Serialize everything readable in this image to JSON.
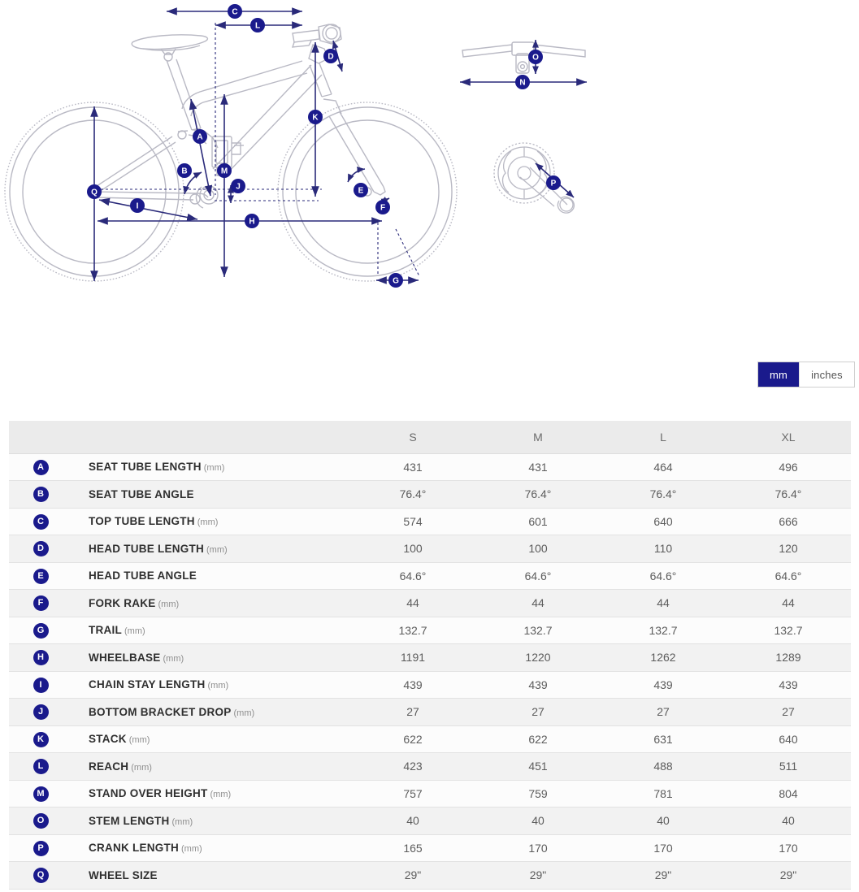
{
  "diagram": {
    "title": "bike-geometry-diagram",
    "line_color": "#2a2a7a",
    "frame_color": "#b9b9c4",
    "callouts": [
      {
        "id": "A",
        "name": "seat-tube-length"
      },
      {
        "id": "B",
        "name": "seat-tube-angle"
      },
      {
        "id": "C",
        "name": "top-tube-length"
      },
      {
        "id": "D",
        "name": "head-tube-length"
      },
      {
        "id": "E",
        "name": "head-tube-angle"
      },
      {
        "id": "F",
        "name": "fork-rake"
      },
      {
        "id": "G",
        "name": "trail"
      },
      {
        "id": "H",
        "name": "wheelbase"
      },
      {
        "id": "I",
        "name": "chain-stay-length"
      },
      {
        "id": "J",
        "name": "bottom-bracket-drop"
      },
      {
        "id": "K",
        "name": "stack"
      },
      {
        "id": "L",
        "name": "reach"
      },
      {
        "id": "M",
        "name": "stand-over-height"
      },
      {
        "id": "N",
        "name": "handlebar-width"
      },
      {
        "id": "O",
        "name": "stem-length"
      },
      {
        "id": "P",
        "name": "crank-length"
      },
      {
        "id": "Q",
        "name": "wheel-size"
      }
    ]
  },
  "units": {
    "selected": "mm",
    "options": [
      {
        "label": "mm",
        "active": true
      },
      {
        "label": "inches",
        "active": false
      }
    ],
    "mm_label": "mm",
    "inches_label": "inches",
    "accent_color": "#1a1a8c"
  },
  "table": {
    "columns": [
      "",
      "",
      "S",
      "M",
      "L",
      "XL"
    ],
    "size_headers": [
      "S",
      "M",
      "L",
      "XL"
    ],
    "rows": [
      {
        "badge": "A",
        "label": "SEAT TUBE LENGTH",
        "unit": "(mm)",
        "values": [
          "431",
          "431",
          "464",
          "496"
        ]
      },
      {
        "badge": "B",
        "label": "SEAT TUBE ANGLE",
        "unit": "",
        "values": [
          "76.4°",
          "76.4°",
          "76.4°",
          "76.4°"
        ]
      },
      {
        "badge": "C",
        "label": "TOP TUBE LENGTH",
        "unit": "(mm)",
        "values": [
          "574",
          "601",
          "640",
          "666"
        ]
      },
      {
        "badge": "D",
        "label": "HEAD TUBE LENGTH",
        "unit": "(mm)",
        "values": [
          "100",
          "100",
          "110",
          "120"
        ]
      },
      {
        "badge": "E",
        "label": "HEAD TUBE ANGLE",
        "unit": "",
        "values": [
          "64.6°",
          "64.6°",
          "64.6°",
          "64.6°"
        ]
      },
      {
        "badge": "F",
        "label": "FORK RAKE",
        "unit": "(mm)",
        "values": [
          "44",
          "44",
          "44",
          "44"
        ]
      },
      {
        "badge": "G",
        "label": "TRAIL",
        "unit": "(mm)",
        "values": [
          "132.7",
          "132.7",
          "132.7",
          "132.7"
        ]
      },
      {
        "badge": "H",
        "label": "WHEELBASE",
        "unit": "(mm)",
        "values": [
          "1191",
          "1220",
          "1262",
          "1289"
        ]
      },
      {
        "badge": "I",
        "label": "CHAIN STAY LENGTH",
        "unit": "(mm)",
        "values": [
          "439",
          "439",
          "439",
          "439"
        ]
      },
      {
        "badge": "J",
        "label": "BOTTOM BRACKET DROP",
        "unit": "(mm)",
        "values": [
          "27",
          "27",
          "27",
          "27"
        ]
      },
      {
        "badge": "K",
        "label": "STACK",
        "unit": "(mm)",
        "values": [
          "622",
          "622",
          "631",
          "640"
        ]
      },
      {
        "badge": "L",
        "label": "REACH",
        "unit": "(mm)",
        "values": [
          "423",
          "451",
          "488",
          "511"
        ]
      },
      {
        "badge": "M",
        "label": "STAND OVER HEIGHT",
        "unit": "(mm)",
        "values": [
          "757",
          "759",
          "781",
          "804"
        ]
      },
      {
        "badge": "O",
        "label": "STEM LENGTH",
        "unit": "(mm)",
        "values": [
          "40",
          "40",
          "40",
          "40"
        ]
      },
      {
        "badge": "P",
        "label": "CRANK LENGTH",
        "unit": "(mm)",
        "values": [
          "165",
          "170",
          "170",
          "170"
        ]
      },
      {
        "badge": "Q",
        "label": "WHEEL SIZE",
        "unit": "",
        "values": [
          "29\"",
          "29\"",
          "29\"",
          "29\""
        ]
      }
    ]
  }
}
